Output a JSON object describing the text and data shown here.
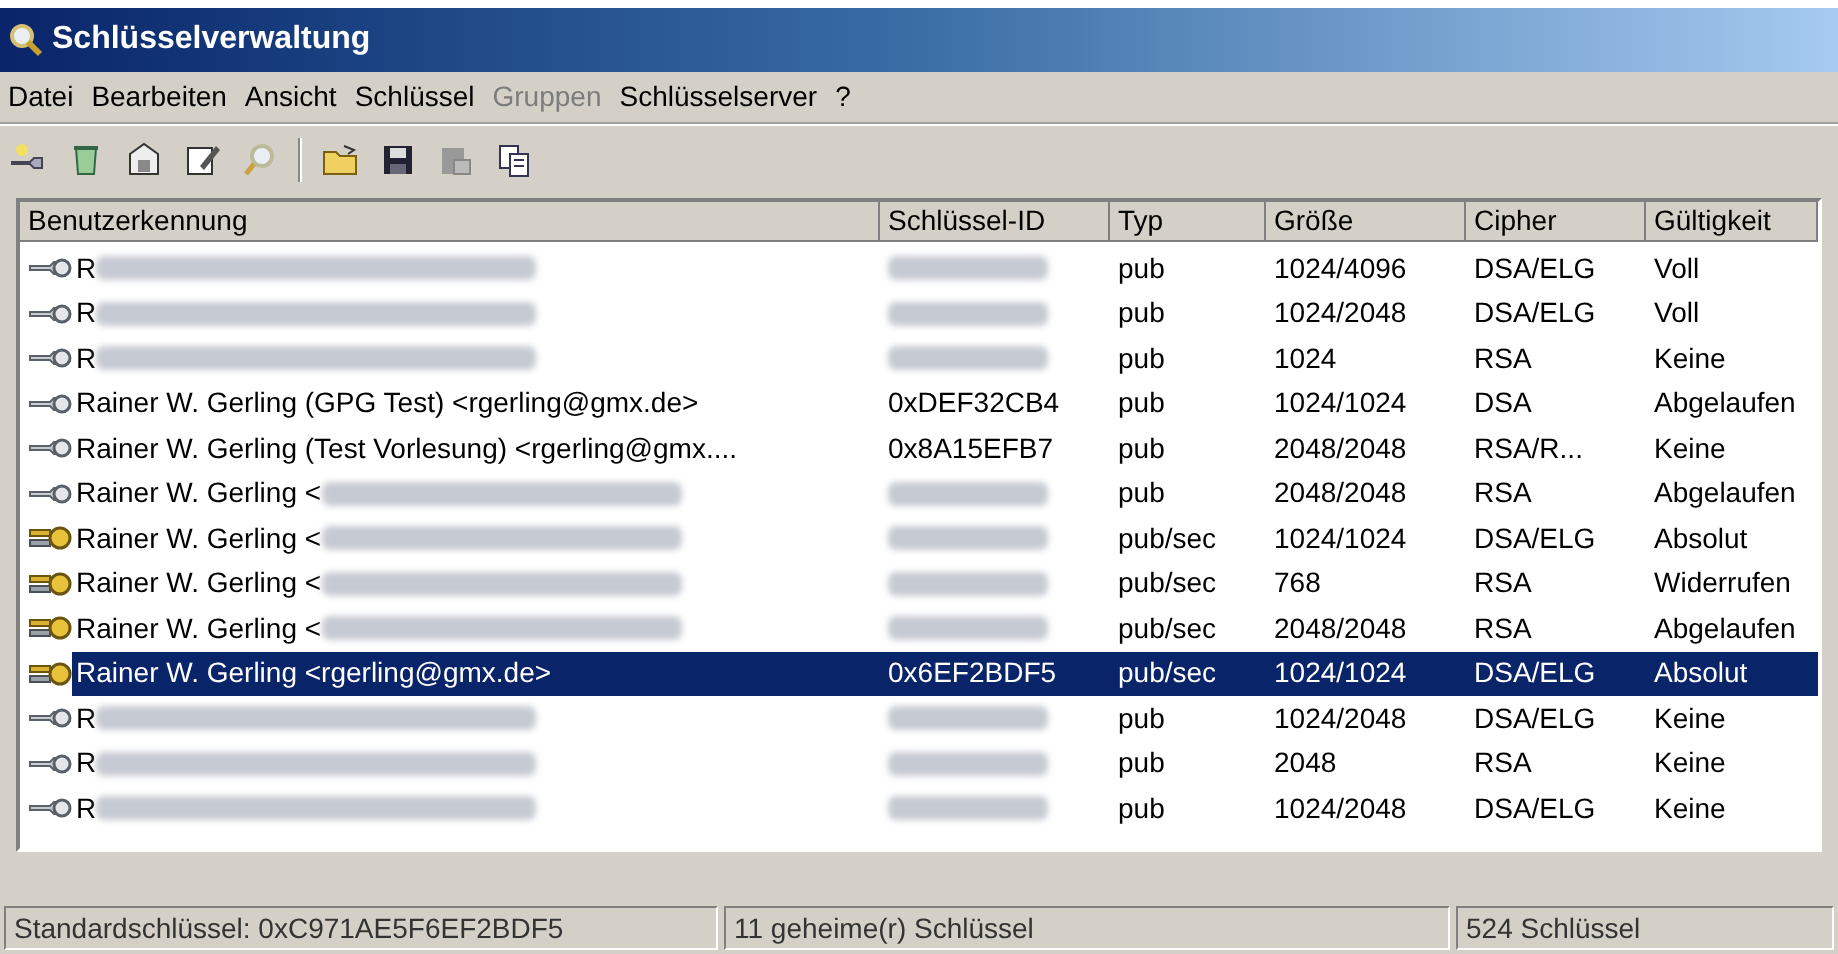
{
  "window": {
    "title": "Schlüsselverwaltung"
  },
  "menu": [
    {
      "label": "Datei",
      "disabled": false
    },
    {
      "label": "Bearbeiten",
      "disabled": false
    },
    {
      "label": "Ansicht",
      "disabled": false
    },
    {
      "label": "Schlüssel",
      "disabled": false
    },
    {
      "label": "Gruppen",
      "disabled": true
    },
    {
      "label": "Schlüsselserver",
      "disabled": false
    },
    {
      "label": "?",
      "disabled": false
    }
  ],
  "table": {
    "columns": [
      "Benutzerkennung",
      "Schlüssel-ID",
      "Typ",
      "Größe",
      "Cipher",
      "Gültigkeit"
    ],
    "rows": [
      {
        "kind": "pub",
        "selected": false,
        "name": "R",
        "name_redacted": true,
        "id_redacted": true,
        "type": "pub",
        "size": "1024/4096",
        "cipher": "DSA/ELG",
        "validity": "Voll"
      },
      {
        "kind": "pub",
        "selected": false,
        "name": "R",
        "name_redacted": true,
        "id_redacted": true,
        "type": "pub",
        "size": "1024/2048",
        "cipher": "DSA/ELG",
        "validity": "Voll"
      },
      {
        "kind": "pub",
        "selected": false,
        "name": "R",
        "name_redacted": true,
        "id_redacted": true,
        "type": "pub",
        "size": "1024",
        "cipher": "RSA",
        "validity": "Keine"
      },
      {
        "kind": "pub",
        "selected": false,
        "name": "Rainer W. Gerling (GPG Test) <rgerling@gmx.de>",
        "name_redacted": false,
        "id": "0xDEF32CB4",
        "id_redacted": false,
        "type": "pub",
        "size": "1024/1024",
        "cipher": "DSA",
        "validity": "Abgelaufen"
      },
      {
        "kind": "pub",
        "selected": false,
        "name": "Rainer W. Gerling (Test Vorlesung) <rgerling@gmx....",
        "name_redacted": false,
        "id": "0x8A15EFB7",
        "id_redacted": false,
        "type": "pub",
        "size": "2048/2048",
        "cipher": "RSA/R...",
        "validity": "Keine"
      },
      {
        "kind": "pub",
        "selected": false,
        "name": "Rainer W. Gerling <",
        "name_redacted": true,
        "id_redacted": true,
        "type": "pub",
        "size": "2048/2048",
        "cipher": "RSA",
        "validity": "Abgelaufen"
      },
      {
        "kind": "pair",
        "selected": false,
        "name": "Rainer W. Gerling <",
        "name_redacted": true,
        "id_redacted": true,
        "type": "pub/sec",
        "size": "1024/1024",
        "cipher": "DSA/ELG",
        "validity": "Absolut"
      },
      {
        "kind": "pair",
        "selected": false,
        "name": "Rainer W. Gerling <",
        "name_redacted": true,
        "id_redacted": true,
        "type": "pub/sec",
        "size": "768",
        "cipher": "RSA",
        "validity": "Widerrufen"
      },
      {
        "kind": "pair",
        "selected": false,
        "name": "Rainer W. Gerling <",
        "name_redacted": true,
        "id_redacted": true,
        "type": "pub/sec",
        "size": "2048/2048",
        "cipher": "RSA",
        "validity": "Abgelaufen"
      },
      {
        "kind": "pair",
        "selected": true,
        "name": "Rainer W. Gerling <rgerling@gmx.de>",
        "name_redacted": false,
        "id": "0x6EF2BDF5",
        "id_redacted": false,
        "type": "pub/sec",
        "size": "1024/1024",
        "cipher": "DSA/ELG",
        "validity": "Absolut"
      },
      {
        "kind": "pub",
        "selected": false,
        "name": "R",
        "name_redacted": true,
        "id_redacted": true,
        "type": "pub",
        "size": "1024/2048",
        "cipher": "DSA/ELG",
        "validity": "Keine"
      },
      {
        "kind": "pub",
        "selected": false,
        "name": "R",
        "name_redacted": true,
        "id_redacted": true,
        "type": "pub",
        "size": "2048",
        "cipher": "RSA",
        "validity": "Keine"
      },
      {
        "kind": "pub",
        "selected": false,
        "name": "R",
        "name_redacted": true,
        "id_redacted": true,
        "type": "pub",
        "size": "1024/2048",
        "cipher": "DSA/ELG",
        "validity": "Keine"
      }
    ]
  },
  "status_bar": [
    "Standardschlüssel: 0xC971AE5F6EF2BDF5",
    "11 geheime(r) Schlüssel",
    "524 Schlüssel"
  ]
}
